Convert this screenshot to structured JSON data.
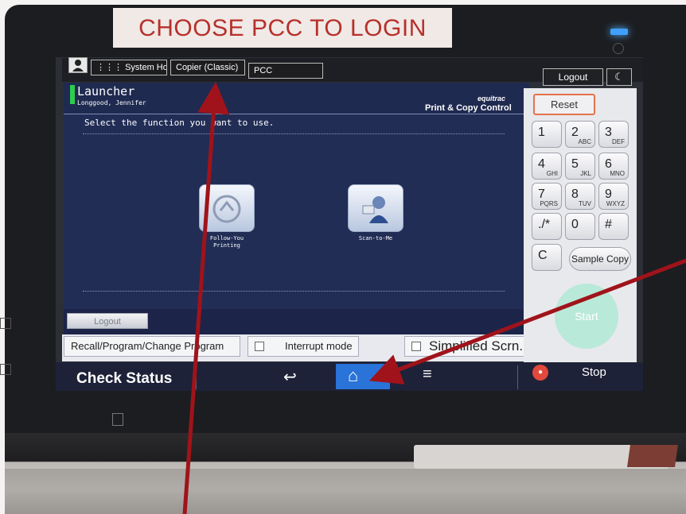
{
  "sign": {
    "text": "CHOOSE PCC TO LOGIN"
  },
  "topbar": {
    "system_home": "System Home",
    "copier_classic": "Copier (Classic)",
    "pcc": "PCC",
    "logout": "Logout"
  },
  "launcher": {
    "title": "Launcher",
    "user": "Longgood, Jennifer",
    "brand_logo": "equitrac",
    "brand_name": "Print & Copy Control",
    "instruction": "Select the function you want to use.",
    "tiles": [
      {
        "label_line1": "Follow-You",
        "label_line2": "Printing"
      },
      {
        "label_line1": "Scan-to-Me",
        "label_line2": ""
      }
    ],
    "logout": "Logout"
  },
  "bottom_buttons": {
    "recall": "Recall/Program/Change Program",
    "interrupt": "Interrupt mode",
    "simplified": "Simplified Scrn."
  },
  "keypad": {
    "reset": "Reset",
    "keys": [
      {
        "d": "1",
        "s": ""
      },
      {
        "d": "2",
        "s": "ABC"
      },
      {
        "d": "3",
        "s": "DEF"
      },
      {
        "d": "4",
        "s": "GHI"
      },
      {
        "d": "5",
        "s": "JKL"
      },
      {
        "d": "6",
        "s": "MNO"
      },
      {
        "d": "7",
        "s": "PQRS"
      },
      {
        "d": "8",
        "s": "TUV"
      },
      {
        "d": "9",
        "s": "WXYZ"
      },
      {
        "d": "./*",
        "s": ""
      },
      {
        "d": "0",
        "s": ""
      },
      {
        "d": "#",
        "s": ""
      },
      {
        "d": "C",
        "s": ""
      }
    ],
    "sample_copy": "Sample Copy",
    "start": "Start"
  },
  "navbar": {
    "check_status": "Check Status",
    "back_icon": "↩",
    "home_icon": "⌂",
    "menu_icon": "≡",
    "stop": "Stop"
  },
  "colors": {
    "launcher_bg": "#212d55",
    "home_active": "#2a73d8",
    "reset_border": "#e4734b",
    "start": "#b9e9d8",
    "annotation_arrow": "#a0131a",
    "sign_text": "#b7302b"
  }
}
